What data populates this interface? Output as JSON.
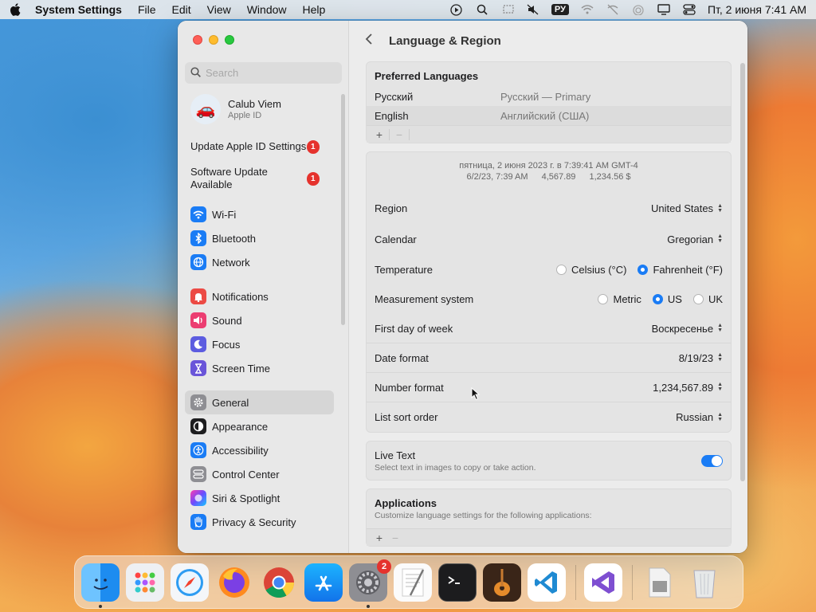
{
  "menubar": {
    "app_name": "System Settings",
    "menus": [
      "File",
      "Edit",
      "View",
      "Window",
      "Help"
    ],
    "input_source": "РУ",
    "datetime": "Пт, 2 июня  7:41 AM"
  },
  "sidebar": {
    "search_placeholder": "Search",
    "account": {
      "name": "Calub Viem",
      "subtitle": "Apple ID"
    },
    "notices": [
      {
        "label": "Update Apple ID Settings",
        "badge": "1"
      },
      {
        "label": "Software Update Available",
        "badge": "1"
      }
    ],
    "group1": [
      {
        "label": "Wi-Fi",
        "icon": "wifi-icon",
        "color": "#1a7cf5"
      },
      {
        "label": "Bluetooth",
        "icon": "bluetooth-icon",
        "color": "#1a7cf5"
      },
      {
        "label": "Network",
        "icon": "globe-icon",
        "color": "#1a7cf5"
      }
    ],
    "group2": [
      {
        "label": "Notifications",
        "icon": "bell-icon",
        "color": "#ec4a44"
      },
      {
        "label": "Sound",
        "icon": "speaker-icon",
        "color": "#ec3d71"
      },
      {
        "label": "Focus",
        "icon": "moon-icon",
        "color": "#5c5ce0"
      },
      {
        "label": "Screen Time",
        "icon": "hourglass-icon",
        "color": "#6a55d9"
      }
    ],
    "group3": [
      {
        "label": "General",
        "icon": "gear-icon",
        "color": "#8e8e93",
        "selected": true
      },
      {
        "label": "Appearance",
        "icon": "appearance-icon",
        "color": "#1d1d1f"
      },
      {
        "label": "Accessibility",
        "icon": "accessibility-icon",
        "color": "#1a7cf5"
      },
      {
        "label": "Control Center",
        "icon": "control-center-icon",
        "color": "#8e8e93"
      },
      {
        "label": "Siri & Spotlight",
        "icon": "siri-icon",
        "color": "#2b2b2b"
      },
      {
        "label": "Privacy & Security",
        "icon": "hand-icon",
        "color": "#1a7cf5"
      }
    ]
  },
  "main": {
    "title": "Language & Region",
    "preferred": {
      "heading": "Preferred Languages",
      "rows": [
        {
          "name": "Русский",
          "detail": "Русский — Primary"
        },
        {
          "name": "English",
          "detail": "Английский (США)"
        }
      ],
      "add": "+",
      "remove": "−"
    },
    "preview": {
      "line1": "пятница, 2 июня 2023 г. в 7:39:41 AM GMT-4",
      "date_short": "6/2/23, 7:39 AM",
      "number": "4,567.89",
      "currency": "1,234.56 $"
    },
    "settings": {
      "region": {
        "label": "Region",
        "value": "United States"
      },
      "calendar": {
        "label": "Calendar",
        "value": "Gregorian"
      },
      "temperature": {
        "label": "Temperature",
        "options": [
          "Celsius (°C)",
          "Fahrenheit (°F)"
        ],
        "selected": "Fahrenheit (°F)"
      },
      "measurement": {
        "label": "Measurement system",
        "options": [
          "Metric",
          "US",
          "UK"
        ],
        "selected": "US"
      },
      "first_day": {
        "label": "First day of week",
        "value": "Воскресенье"
      },
      "date_format": {
        "label": "Date format",
        "value": "8/19/23"
      },
      "number_format": {
        "label": "Number format",
        "value": "1,234,567.89"
      },
      "sort_order": {
        "label": "List sort order",
        "value": "Russian"
      }
    },
    "live_text": {
      "label": "Live Text",
      "description": "Select text in images to copy or take action.",
      "enabled": true
    },
    "applications": {
      "heading": "Applications",
      "description": "Customize language settings for the following applications:",
      "add": "+",
      "remove": "−"
    }
  },
  "dock": {
    "apps": [
      "Finder",
      "Launchpad",
      "Safari",
      "Firefox",
      "Chrome",
      "App Store",
      "System Settings",
      "TextEdit",
      "Terminal",
      "GarageBand",
      "Visual Studio Code",
      "Visual Studio",
      "Preview",
      "Trash"
    ],
    "settings_badge": "2"
  }
}
